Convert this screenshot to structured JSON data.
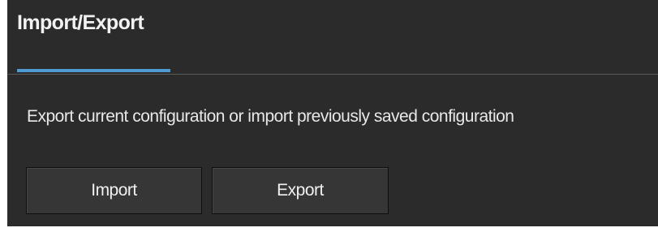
{
  "panel": {
    "title": "Import/Export",
    "description": "Export current configuration or import previously saved configuration",
    "accent_color": "#4e9bd2",
    "background_color": "#2b2b2b"
  },
  "buttons": {
    "import_label": "Import",
    "export_label": "Export"
  }
}
